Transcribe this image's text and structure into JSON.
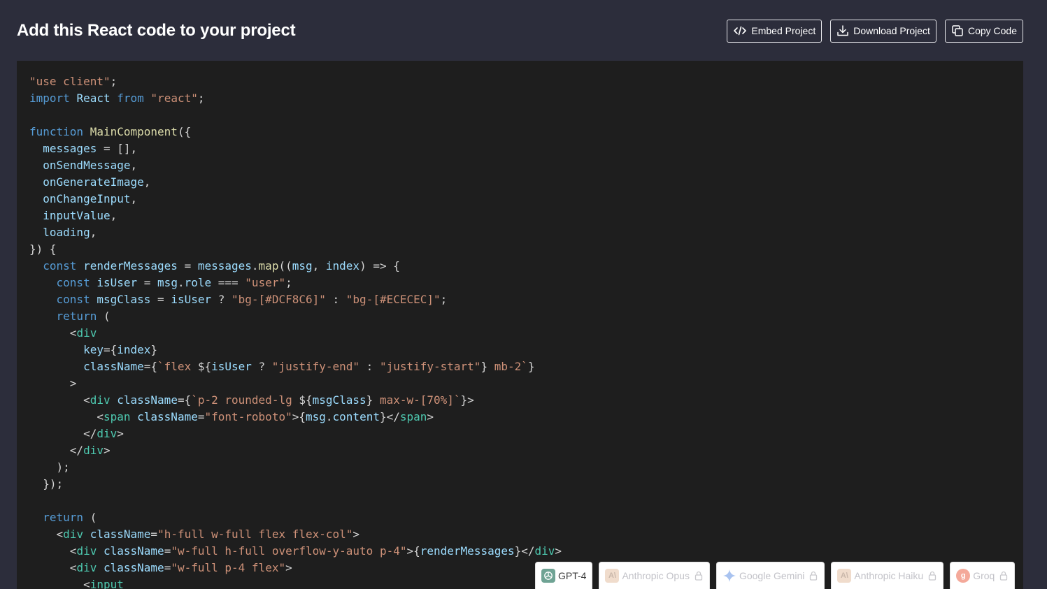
{
  "header": {
    "title": "Add this React code to your project",
    "buttons": [
      {
        "label": "Embed Project",
        "icon": "code-icon"
      },
      {
        "label": "Download Project",
        "icon": "download-icon"
      },
      {
        "label": "Copy Code",
        "icon": "copy-icon"
      }
    ]
  },
  "code": {
    "lines": [
      [
        [
          "str",
          "\"use client\""
        ],
        [
          "pl",
          ";"
        ]
      ],
      [
        [
          "kw",
          "import"
        ],
        [
          "pl",
          " "
        ],
        [
          "var",
          "React"
        ],
        [
          "pl",
          " "
        ],
        [
          "kw",
          "from"
        ],
        [
          "pl",
          " "
        ],
        [
          "str",
          "\"react\""
        ],
        [
          "pl",
          ";"
        ]
      ],
      [],
      [
        [
          "kw",
          "function"
        ],
        [
          "pl",
          " "
        ],
        [
          "fn",
          "MainComponent"
        ],
        [
          "pl",
          "({"
        ]
      ],
      [
        [
          "pl",
          "  "
        ],
        [
          "var",
          "messages"
        ],
        [
          "pl",
          " = [],"
        ]
      ],
      [
        [
          "pl",
          "  "
        ],
        [
          "var",
          "onSendMessage"
        ],
        [
          "pl",
          ","
        ]
      ],
      [
        [
          "pl",
          "  "
        ],
        [
          "var",
          "onGenerateImage"
        ],
        [
          "pl",
          ","
        ]
      ],
      [
        [
          "pl",
          "  "
        ],
        [
          "var",
          "onChangeInput"
        ],
        [
          "pl",
          ","
        ]
      ],
      [
        [
          "pl",
          "  "
        ],
        [
          "var",
          "inputValue"
        ],
        [
          "pl",
          ","
        ]
      ],
      [
        [
          "pl",
          "  "
        ],
        [
          "var",
          "loading"
        ],
        [
          "pl",
          ","
        ]
      ],
      [
        [
          "pl",
          "}) {"
        ]
      ],
      [
        [
          "pl",
          "  "
        ],
        [
          "kw",
          "const"
        ],
        [
          "pl",
          " "
        ],
        [
          "var",
          "renderMessages"
        ],
        [
          "pl",
          " = "
        ],
        [
          "var",
          "messages"
        ],
        [
          "pl",
          "."
        ],
        [
          "fn",
          "map"
        ],
        [
          "pl",
          "(("
        ],
        [
          "var",
          "msg"
        ],
        [
          "pl",
          ", "
        ],
        [
          "var",
          "index"
        ],
        [
          "pl",
          ") => {"
        ]
      ],
      [
        [
          "pl",
          "    "
        ],
        [
          "kw",
          "const"
        ],
        [
          "pl",
          " "
        ],
        [
          "var",
          "isUser"
        ],
        [
          "pl",
          " = "
        ],
        [
          "var",
          "msg"
        ],
        [
          "pl",
          "."
        ],
        [
          "var",
          "role"
        ],
        [
          "pl",
          " === "
        ],
        [
          "str",
          "\"user\""
        ],
        [
          "pl",
          ";"
        ]
      ],
      [
        [
          "pl",
          "    "
        ],
        [
          "kw",
          "const"
        ],
        [
          "pl",
          " "
        ],
        [
          "var",
          "msgClass"
        ],
        [
          "pl",
          " = "
        ],
        [
          "var",
          "isUser"
        ],
        [
          "pl",
          " ? "
        ],
        [
          "str",
          "\"bg-[#DCF8C6]\""
        ],
        [
          "pl",
          " : "
        ],
        [
          "str",
          "\"bg-[#ECECEC]\""
        ],
        [
          "pl",
          ";"
        ]
      ],
      [
        [
          "pl",
          "    "
        ],
        [
          "kw",
          "return"
        ],
        [
          "pl",
          " ("
        ]
      ],
      [
        [
          "pl",
          "      <"
        ],
        [
          "tag",
          "div"
        ]
      ],
      [
        [
          "pl",
          "        "
        ],
        [
          "attr",
          "key"
        ],
        [
          "pl",
          "={"
        ],
        [
          "var",
          "index"
        ],
        [
          "pl",
          "}"
        ]
      ],
      [
        [
          "pl",
          "        "
        ],
        [
          "attr",
          "className"
        ],
        [
          "pl",
          "={"
        ],
        [
          "str",
          "`flex "
        ],
        [
          "pl",
          "${"
        ],
        [
          "var",
          "isUser"
        ],
        [
          "pl",
          " ? "
        ],
        [
          "str",
          "\"justify-end\""
        ],
        [
          "pl",
          " : "
        ],
        [
          "str",
          "\"justify-start\""
        ],
        [
          "pl",
          "}"
        ],
        [
          "str",
          " mb-2`"
        ],
        [
          "pl",
          "}"
        ]
      ],
      [
        [
          "pl",
          "      >"
        ]
      ],
      [
        [
          "pl",
          "        <"
        ],
        [
          "tag",
          "div"
        ],
        [
          "pl",
          " "
        ],
        [
          "attr",
          "className"
        ],
        [
          "pl",
          "={"
        ],
        [
          "str",
          "`p-2 rounded-lg "
        ],
        [
          "pl",
          "${"
        ],
        [
          "var",
          "msgClass"
        ],
        [
          "pl",
          "}"
        ],
        [
          "str",
          " max-w-[70%]`"
        ],
        [
          "pl",
          "}>"
        ]
      ],
      [
        [
          "pl",
          "          <"
        ],
        [
          "tag",
          "span"
        ],
        [
          "pl",
          " "
        ],
        [
          "attr",
          "className"
        ],
        [
          "pl",
          "="
        ],
        [
          "str",
          "\"font-roboto\""
        ],
        [
          "pl",
          ">{"
        ],
        [
          "var",
          "msg"
        ],
        [
          "pl",
          "."
        ],
        [
          "var",
          "content"
        ],
        [
          "pl",
          "}</"
        ],
        [
          "tag",
          "span"
        ],
        [
          "pl",
          ">"
        ]
      ],
      [
        [
          "pl",
          "        </"
        ],
        [
          "tag",
          "div"
        ],
        [
          "pl",
          ">"
        ]
      ],
      [
        [
          "pl",
          "      </"
        ],
        [
          "tag",
          "div"
        ],
        [
          "pl",
          ">"
        ]
      ],
      [
        [
          "pl",
          "    );"
        ]
      ],
      [
        [
          "pl",
          "  });"
        ]
      ],
      [],
      [
        [
          "pl",
          "  "
        ],
        [
          "kw",
          "return"
        ],
        [
          "pl",
          " ("
        ]
      ],
      [
        [
          "pl",
          "    <"
        ],
        [
          "tag",
          "div"
        ],
        [
          "pl",
          " "
        ],
        [
          "attr",
          "className"
        ],
        [
          "pl",
          "="
        ],
        [
          "str",
          "\"h-full w-full flex flex-col\""
        ],
        [
          "pl",
          ">"
        ]
      ],
      [
        [
          "pl",
          "      <"
        ],
        [
          "tag",
          "div"
        ],
        [
          "pl",
          " "
        ],
        [
          "attr",
          "className"
        ],
        [
          "pl",
          "="
        ],
        [
          "str",
          "\"w-full h-full overflow-y-auto p-4\""
        ],
        [
          "pl",
          ">{"
        ],
        [
          "var",
          "renderMessages"
        ],
        [
          "pl",
          "}</"
        ],
        [
          "tag",
          "div"
        ],
        [
          "pl",
          ">"
        ]
      ],
      [
        [
          "pl",
          "      <"
        ],
        [
          "tag",
          "div"
        ],
        [
          "pl",
          " "
        ],
        [
          "attr",
          "className"
        ],
        [
          "pl",
          "="
        ],
        [
          "str",
          "\"w-full p-4 flex\""
        ],
        [
          "pl",
          ">"
        ]
      ],
      [
        [
          "pl",
          "        <"
        ],
        [
          "tag",
          "input"
        ]
      ]
    ]
  },
  "models": [
    {
      "label": "GPT-4",
      "icon": "openai-icon",
      "active": true
    },
    {
      "label": "Anthropic Opus",
      "icon": "anthropic-icon",
      "active": false
    },
    {
      "label": "Google Gemini",
      "icon": "gemini-icon",
      "active": false
    },
    {
      "label": "Anthropic Haiku",
      "icon": "anthropic-icon",
      "active": false
    },
    {
      "label": "Groq",
      "icon": "groq-icon",
      "active": false
    }
  ],
  "colors": {
    "page_bg": "#2c2d3b",
    "code_bg": "#1e1e1e",
    "keyword": "#569cd6",
    "string": "#ce9178",
    "function": "#dcdcaa",
    "variable": "#9cdcfe",
    "tag": "#4ec9b0"
  }
}
